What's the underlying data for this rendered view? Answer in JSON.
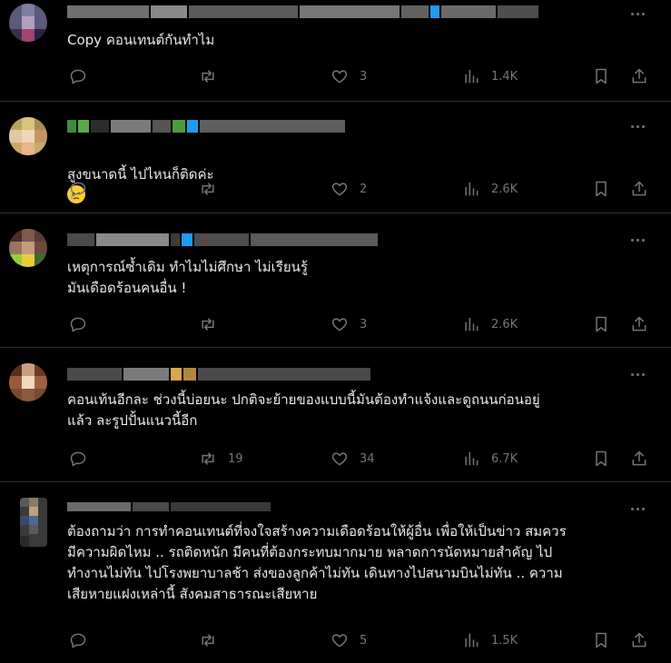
{
  "colors": {
    "background": "#000000",
    "text": "#e7e9ea",
    "muted": "#71767b",
    "divider": "#2f3336"
  },
  "posts": [
    {
      "text": "Copy คอนเทนต์กันทำไม",
      "reply_count": "",
      "retweet_count": "",
      "like_count": "3",
      "views": "1.4K"
    },
    {
      "text": "สูงขนาดนี้ ไปไหนก็ติดค่ะ",
      "emoji": "crying-face",
      "reply_count": "",
      "retweet_count": "",
      "like_count": "2",
      "views": "2.6K"
    },
    {
      "text": "เหตุการณ์ซ้ำเดิม ทำไมไม่ศึกษา ไม่เรียนรู้\nมันเดือดร้อนคนอื่น !",
      "reply_count": "",
      "retweet_count": "",
      "like_count": "3",
      "views": "2.6K"
    },
    {
      "text": "คอนเท้นอีกละ ช่วงนี้บ่อยนะ ปกติจะย้ายของแบบนี้มันต้องทำแจ้งและดูถนนก่อนอยู่\nแล้ว ละรูปปั้นแนวนี้อีก",
      "reply_count": "",
      "retweet_count": "19",
      "like_count": "34",
      "views": "6.7K"
    },
    {
      "text": "ต้องถามว่า การทำคอนเทนต์ที่จงใจสร้างความเดือดร้อนให้ผู้อื่น เพื่อให้เป็นข่าว สมควร\nมีความผิดไหม .. รถติดหนัก มีคนที่ต้องกระทบมากมาย พลาดการนัดหมายสำคัญ ไป\nทำงานไม่ทัน ไปโรงพยาบาลช้า ส่งของลูกค้าไม่ทัน เดินทางไปสนามบินไม่ทัน .. ความ\nเสียหายแฝงเหล่านี้ สังคมสาธารณะเสียหาย",
      "reply_count": "",
      "retweet_count": "",
      "like_count": "5",
      "views": "1.5K"
    }
  ],
  "icons": [
    "reply-icon",
    "retweet-icon",
    "like-icon",
    "views-icon",
    "bookmark-icon",
    "share-icon",
    "more-icon"
  ]
}
